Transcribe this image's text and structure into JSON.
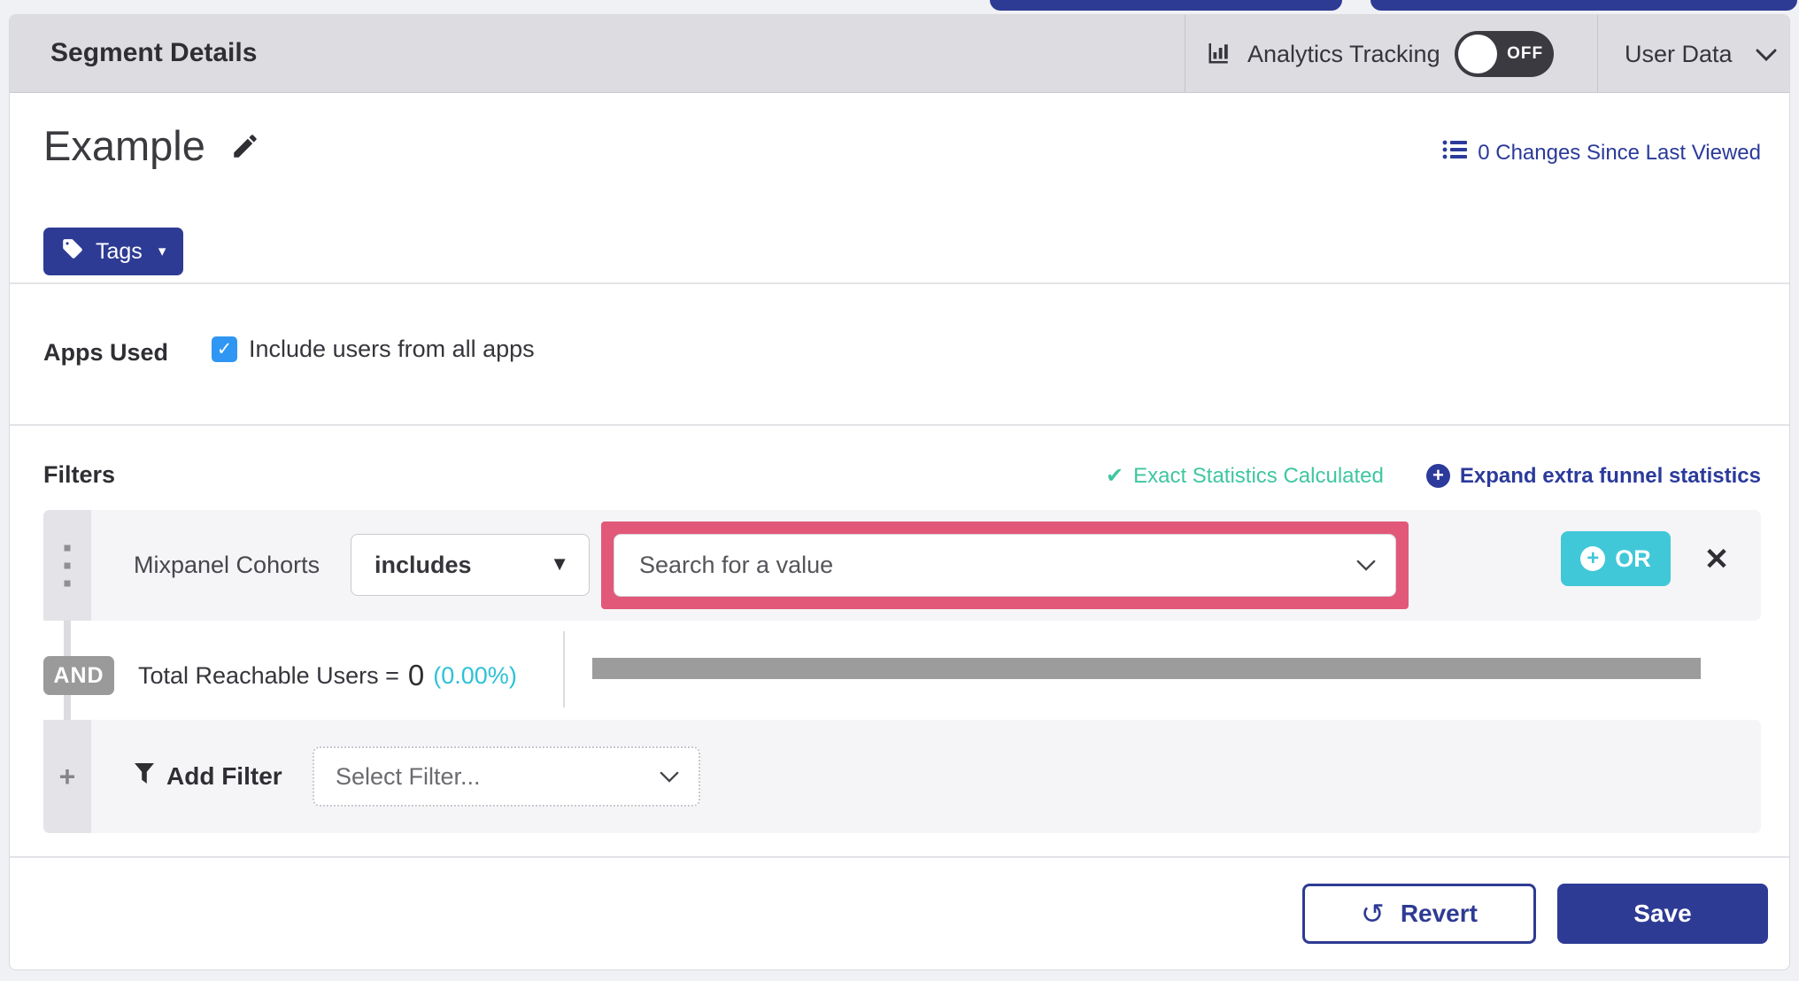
{
  "colors": {
    "indigo": "#2e3b94",
    "link_indigo": "#2b3a9b",
    "teal_or_button": "#41c8d8",
    "green_status": "#3fc6a0",
    "cyan_percent": "#2cc2d6",
    "checkbox_blue": "#2f96f3",
    "highlight_pink": "#e25878",
    "header_bg": "#dcdce1",
    "toggle_off_bg": "#3a3a40",
    "and_badge_gray": "#9a9a9a",
    "progress_bar_gray": "#9c9c9c"
  },
  "header": {
    "title": "Segment Details",
    "analytics_tracking_label": "Analytics Tracking",
    "toggle_state": "OFF",
    "user_data_label": "User Data"
  },
  "segment": {
    "name": "Example",
    "changes_link": "0 Changes Since Last Viewed",
    "tags_button_label": "Tags"
  },
  "apps_used": {
    "label": "Apps Used",
    "checkbox_label": "Include users from all apps",
    "checkbox_checked": true
  },
  "filters": {
    "heading": "Filters",
    "exact_stats_label": "Exact Statistics Calculated",
    "expand_link_label": "Expand extra funnel statistics",
    "row": {
      "filter_name": "Mixpanel Cohorts",
      "operator": "includes",
      "value_placeholder": "Search for a value",
      "or_button_label": "OR"
    },
    "and_label": "AND",
    "reachable_label": "Total Reachable Users =",
    "reachable_value": "0",
    "reachable_percent": "(0.00%)",
    "add_filter_label": "Add Filter",
    "select_filter_placeholder": "Select Filter..."
  },
  "footer": {
    "revert_label": "Revert",
    "save_label": "Save"
  }
}
